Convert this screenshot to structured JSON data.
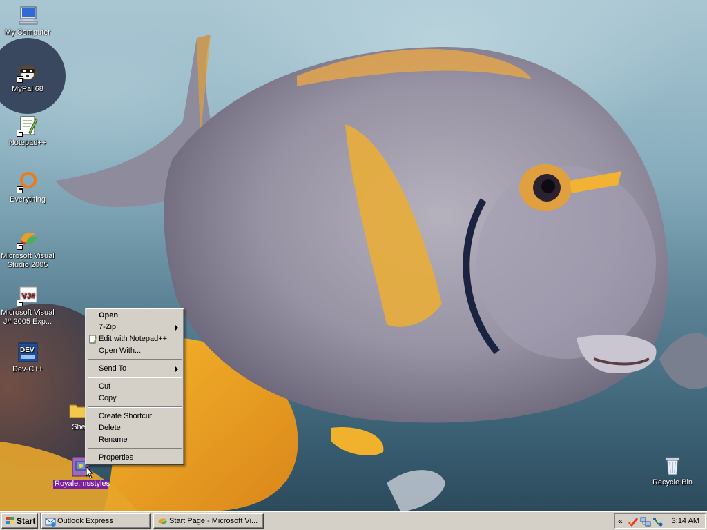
{
  "desktop": {
    "icons": [
      {
        "label": "My Computer",
        "icon": "my-computer-icon"
      },
      {
        "label": "MyPal 68",
        "icon": "mypal-icon"
      },
      {
        "label": "Notepad++",
        "icon": "notepadpp-icon"
      },
      {
        "label": "Everything",
        "icon": "everything-icon"
      },
      {
        "label": "Microsoft Visual Studio 2005",
        "icon": "visual-studio-icon"
      },
      {
        "label": "Microsoft Visual J# 2005 Exp...",
        "icon": "visual-jsharp-icon"
      },
      {
        "label": "Dev-C++",
        "icon": "devcpp-icon"
      },
      {
        "label": "She",
        "icon": "folder-icon"
      },
      {
        "label": "Royale.msstyles",
        "icon": "msstyles-file-icon"
      }
    ],
    "recycle_bin": {
      "label": "Recycle Bin",
      "icon": "recycle-bin-icon"
    }
  },
  "context_menu": {
    "items": [
      {
        "label": "Open",
        "bold": true
      },
      {
        "label": "7-Zip",
        "submenu": true
      },
      {
        "label": "Edit with Notepad++",
        "icon": "notepadpp-small-icon"
      },
      {
        "label": "Open With..."
      },
      {
        "label": "Send To",
        "submenu": true
      },
      {
        "label": "Cut"
      },
      {
        "label": "Copy"
      },
      {
        "label": "Create Shortcut"
      },
      {
        "label": "Delete"
      },
      {
        "label": "Rename"
      },
      {
        "label": "Properties"
      }
    ]
  },
  "taskbar": {
    "start_label": "Start",
    "tasks": [
      {
        "label": "Outlook Express",
        "icon": "outlook-express-icon"
      },
      {
        "label": "Start Page - Microsoft Vi...",
        "icon": "visual-studio-icon"
      }
    ],
    "tray": {
      "chevron": "«",
      "clock": "3:14 AM"
    }
  },
  "colors": {
    "selection": "#7b1fa2",
    "chrome": "#d4d0c8"
  }
}
